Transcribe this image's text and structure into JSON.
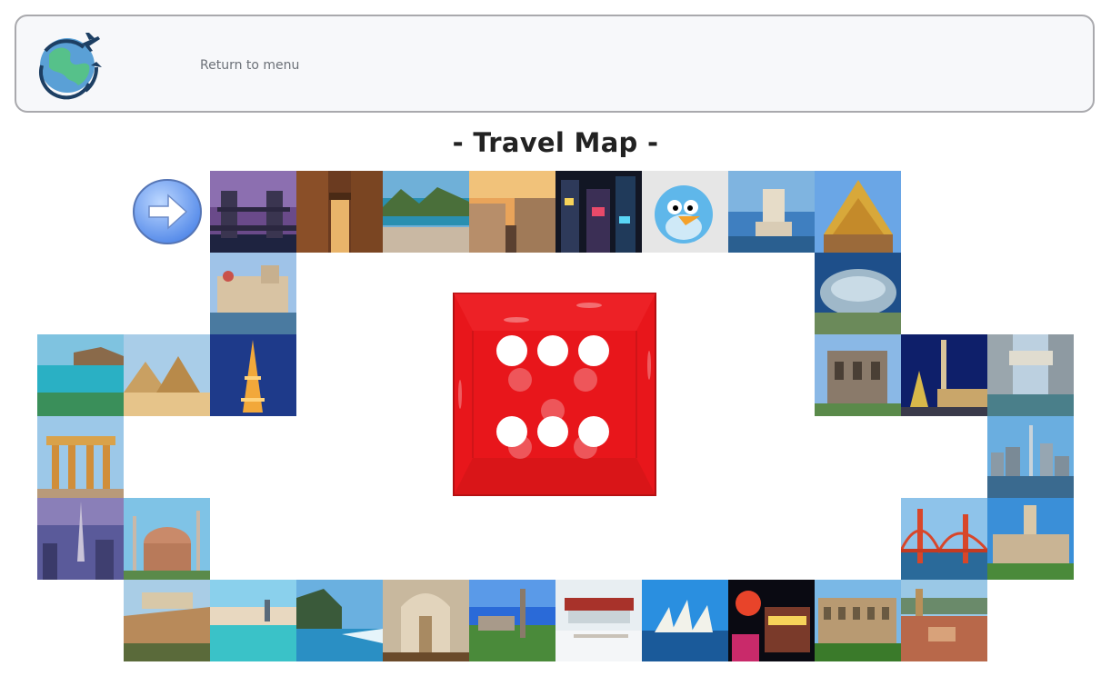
{
  "header": {
    "logo_icon": "globe-plane-icon",
    "return_label": "Return to menu"
  },
  "map": {
    "title": "- Travel Map -",
    "start_icon": "right-arrow-icon",
    "die_value": 6,
    "die_color": "#e8161b"
  },
  "tiles": [
    {
      "name": "tile-tower-bridge",
      "scene": "tower-bridge"
    },
    {
      "name": "tile-old-alley",
      "scene": "alley"
    },
    {
      "name": "tile-rio-bay",
      "scene": "bay"
    },
    {
      "name": "tile-madrid-street",
      "scene": "city-sunset"
    },
    {
      "name": "tile-times-square",
      "scene": "night-city"
    },
    {
      "name": "tile-blue-bird",
      "scene": "bird"
    },
    {
      "name": "tile-belem-tower",
      "scene": "tower-sea"
    },
    {
      "name": "tile-thai-temple",
      "scene": "temple"
    },
    {
      "name": "tile-gateway-india",
      "scene": "palace-water"
    },
    {
      "name": "tile-cloud-gate",
      "scene": "bean"
    },
    {
      "name": "tile-hawaii-bay",
      "scene": "beach"
    },
    {
      "name": "tile-pyramids",
      "scene": "pyramids"
    },
    {
      "name": "tile-eiffel-tower",
      "scene": "eiffel"
    },
    {
      "name": "tile-ruins-facade",
      "scene": "facade"
    },
    {
      "name": "tile-christmas-square",
      "scene": "square-night"
    },
    {
      "name": "tile-venice-bridge",
      "scene": "canal"
    },
    {
      "name": "tile-brandenburg-gate",
      "scene": "gate"
    },
    {
      "name": "tile-toronto-skyline",
      "scene": "skyline"
    },
    {
      "name": "tile-dubai-skyline",
      "scene": "dubai"
    },
    {
      "name": "tile-hagia-sophia",
      "scene": "mosque"
    },
    {
      "name": "tile-golden-gate",
      "scene": "golden-gate"
    },
    {
      "name": "tile-parliament-hill",
      "scene": "parliament"
    },
    {
      "name": "tile-acropolis",
      "scene": "acropolis"
    },
    {
      "name": "tile-lake-town",
      "scene": "lake"
    },
    {
      "name": "tile-sea-temple",
      "scene": "cliff-sea"
    },
    {
      "name": "tile-cathedral-interior",
      "scene": "interior"
    },
    {
      "name": "tile-green-city",
      "scene": "green-city"
    },
    {
      "name": "tile-snow-palace",
      "scene": "snow"
    },
    {
      "name": "tile-sydney-opera",
      "scene": "opera"
    },
    {
      "name": "tile-las-vegas",
      "scene": "vegas"
    },
    {
      "name": "tile-colosseum",
      "scene": "colosseum"
    },
    {
      "name": "tile-tuscan-town",
      "scene": "tuscany"
    }
  ]
}
